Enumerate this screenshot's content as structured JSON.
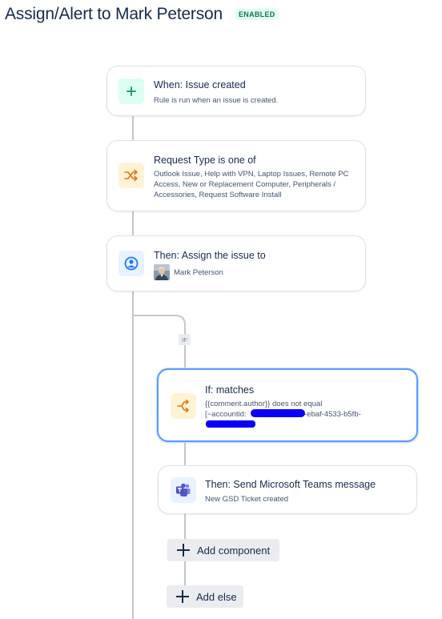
{
  "header": {
    "title": "Assign/Alert to Mark Peterson",
    "status": "ENABLED"
  },
  "colors": {
    "accent": "#579dff",
    "status_green": "#216e4e",
    "trigger_green": "#22a06b",
    "condition_orange": "#e2740f",
    "action_blue": "#1d7afc"
  },
  "flow": {
    "trigger": {
      "icon": "plus-icon",
      "title": "When: Issue created",
      "description": "Rule is run when an issue is created."
    },
    "condition": {
      "icon": "shuffle-icon",
      "title": "Request Type is one of",
      "description": "Outlook Issue, Help with VPN, Laptop Issues, Remote PC Access, New or Replacement Computer, Peripherals / Accessories, Request Software Install"
    },
    "assign_action": {
      "icon": "user-circle-icon",
      "title": "Then: Assign the issue to",
      "assignee": "Mark Peterson"
    },
    "branch": {
      "badge": "IF",
      "if_block": {
        "icon": "branch-icon",
        "title": "If: matches",
        "line1": "{{comment.author}} does not equal",
        "line2_prefix": "[~accountid:",
        "line2_suffix": "-ebaf-4533-b5fb-"
      },
      "teams_action": {
        "icon": "teams-icon",
        "title": "Then: Send Microsoft Teams message",
        "description": "New GSD Ticket created"
      },
      "add_component_label": "Add component",
      "add_else_label": "Add else"
    }
  }
}
